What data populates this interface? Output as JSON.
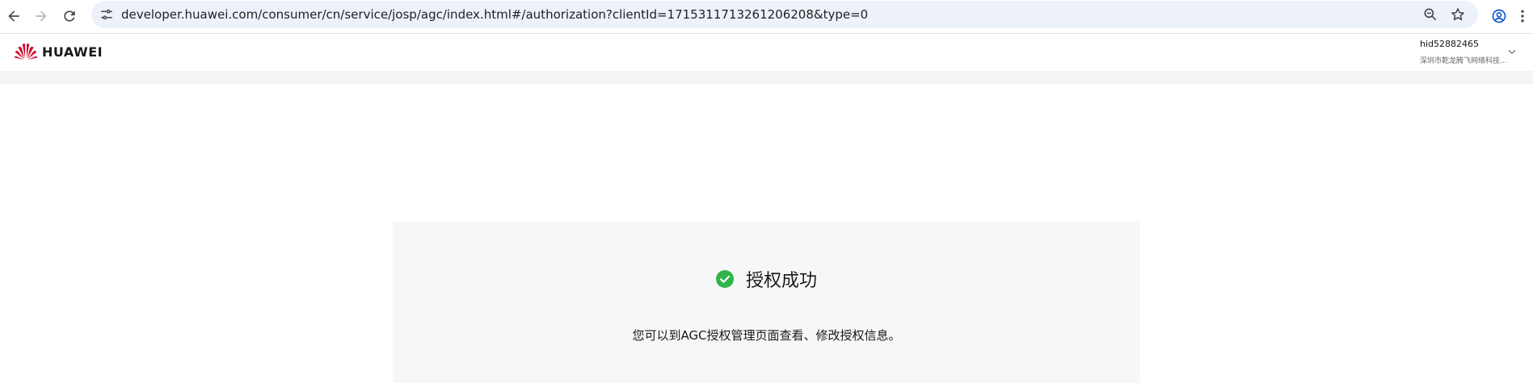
{
  "browser": {
    "url": "developer.huawei.com/consumer/cn/service/josp/agc/index.html#/authorization?clientId=1715311713261206208&type=0"
  },
  "header": {
    "logo_text": "HUAWEI",
    "user_id": "hid52882465",
    "user_org": "深圳市乾龙腾飞网络科技..."
  },
  "status": {
    "title": "授权成功",
    "description": "您可以到AGC授权管理页面查看、修改授权信息。"
  },
  "colors": {
    "success": "#2fb44a",
    "brand_red": "#cf0a2c",
    "card_bg": "#f7f7f7",
    "page_band": "#f4f4f4",
    "omnibox_bg": "#edf2fa"
  }
}
